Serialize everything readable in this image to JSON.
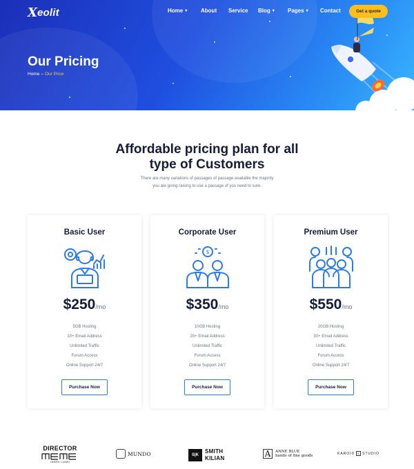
{
  "header": {
    "logo_mark": "X",
    "logo_text": "eolit",
    "nav": [
      {
        "label": "Home",
        "has_dropdown": true
      },
      {
        "label": "About",
        "has_dropdown": false
      },
      {
        "label": "Service",
        "has_dropdown": false
      },
      {
        "label": "Blog",
        "has_dropdown": true
      },
      {
        "label": "Pages",
        "has_dropdown": true
      },
      {
        "label": "Contact",
        "has_dropdown": false
      }
    ],
    "quote_button": "Get a quote"
  },
  "hero": {
    "title": "Our Pricing",
    "breadcrumb_home": "Home",
    "breadcrumb_sep": "–",
    "breadcrumb_current": "Our Price"
  },
  "section": {
    "title_line1": "Affordable pricing plan for all",
    "title_line2": "type of Customers",
    "subtitle_line1": "There are many variations of passages of passage available the majority",
    "subtitle_line2": "you are going raising to use a passage of you need to sure."
  },
  "plans": [
    {
      "name": "Basic User",
      "icon": "user-chart-icon",
      "price": "$250",
      "period": "/mo",
      "features": [
        "5GB Hosting",
        "10+ Email Address",
        "Unlimited Traffic",
        "Forum Access",
        "Online Support 24/7"
      ],
      "button": "Purchase Now"
    },
    {
      "name": "Corporate User",
      "icon": "business-partners-icon",
      "price": "$350",
      "period": "/mo",
      "features": [
        "10GB Hosting",
        "20+ Email Address",
        "Unlimited Traffic",
        "Forum Access",
        "Online Support 24/7"
      ],
      "button": "Purchase Now"
    },
    {
      "name": "Premium User",
      "icon": "team-group-icon",
      "price": "$550",
      "period": "/mo",
      "features": [
        "20GB Hosting",
        "30+ Email Address",
        "Unlimited Traffic",
        "Forum Access",
        "Online Support 24/7"
      ],
      "button": "Purchase Now"
    }
  ],
  "brands": {
    "director": {
      "title": "DIRECTOR",
      "tagline": "JAMES LIAMU"
    },
    "mundo": {
      "name": "MUNDO"
    },
    "smith": {
      "mark": "S|K",
      "line1": "SMITH",
      "line2": "KILIAN"
    },
    "anne": {
      "mark": "A",
      "line1": "ANNE BLUE",
      "line2": "hands of fine goods"
    },
    "karoid": {
      "text1": "KAROID",
      "mark": "S",
      "text2": "STUDIO"
    }
  },
  "colors": {
    "hero_start": "#1b2fb8",
    "hero_end": "#39b6ff",
    "accent_yellow": "#ffbf1a",
    "icon_blue": "#2a7be4",
    "heading": "#141c38"
  }
}
